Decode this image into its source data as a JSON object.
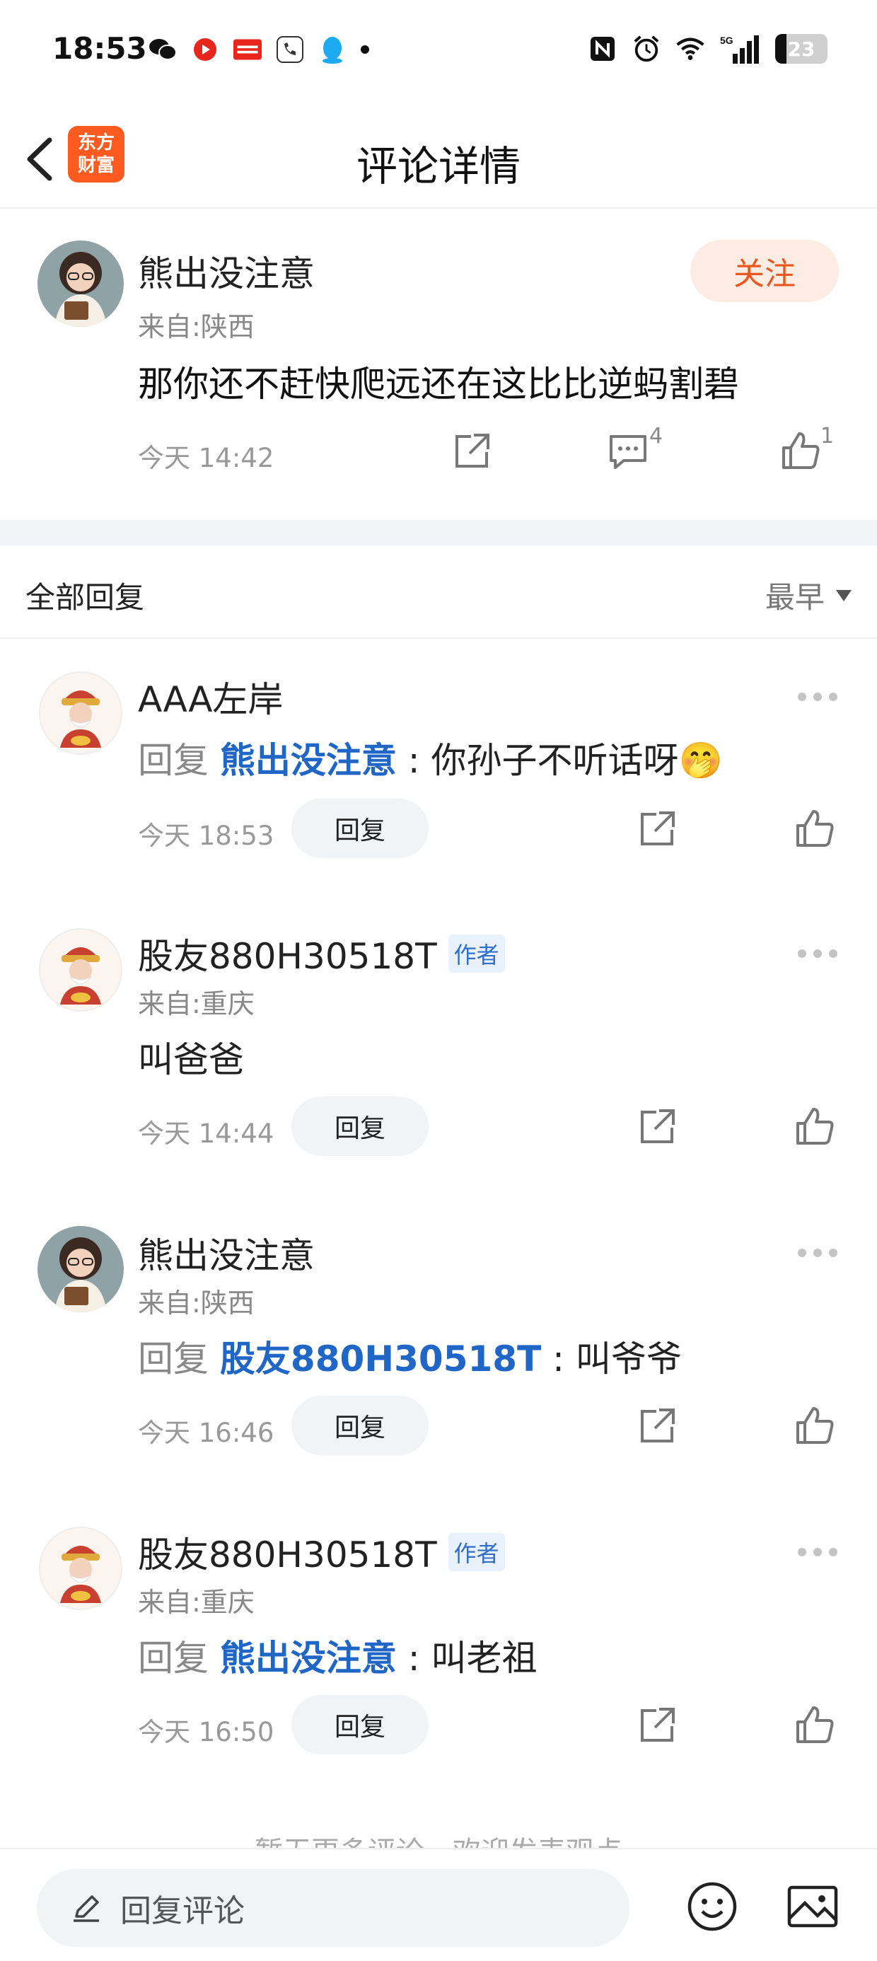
{
  "status_bar": {
    "time": "18:53",
    "battery": "23",
    "network": "5G"
  },
  "header": {
    "title": "评论详情",
    "logo_text": "东方财富"
  },
  "main_comment": {
    "user": "熊出没注意",
    "location": "来自:陕西",
    "text": "那你还不赶快爬远还在这比比逆蚂割碧",
    "follow_label": "关注",
    "time": "今天 14:42",
    "comment_count": "4",
    "like_count": "1"
  },
  "section": {
    "title": "全部回复",
    "sort_label": "最早"
  },
  "reply_button_label": "回复",
  "reply_prefix": "回复",
  "replies": [
    {
      "user": "AAA左岸",
      "target": "熊出没注意",
      "text": " : 你孙子不听话呀🤭",
      "time": "今天 18:53"
    },
    {
      "user": "股友880H30518T",
      "badge": "作者",
      "location": "来自:重庆",
      "text": "叫爸爸",
      "time": "今天 14:44"
    },
    {
      "user": "熊出没注意",
      "location": "来自:陕西",
      "target": "股友880H30518T",
      "text": " : 叫爷爷",
      "time": "今天 16:46"
    },
    {
      "user": "股友880H30518T",
      "badge": "作者",
      "location": "来自:重庆",
      "target": "熊出没注意",
      "text": " : 叫老祖",
      "time": "今天 16:50"
    }
  ],
  "end_text": "暂无更多评论，欢迎发表观点",
  "bottom_bar": {
    "placeholder": "回复评论"
  }
}
